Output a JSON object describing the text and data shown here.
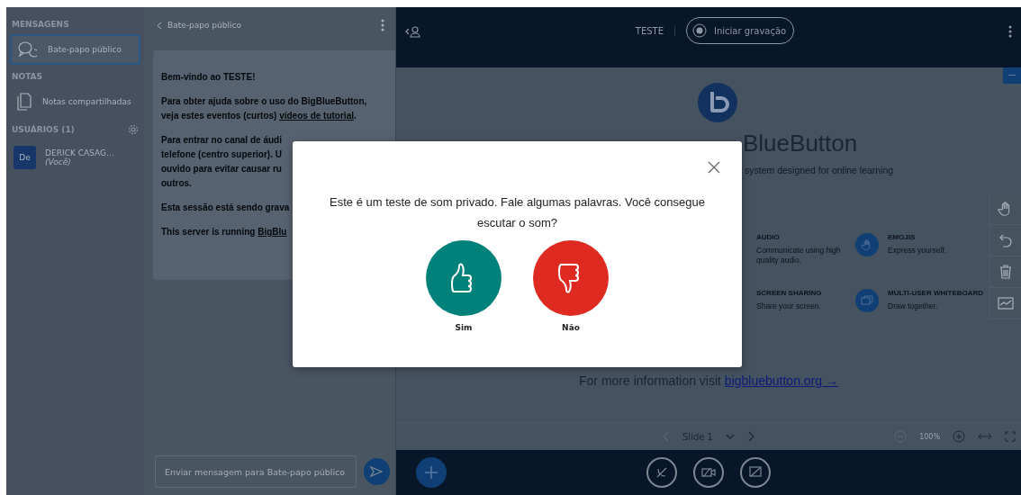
{
  "sidebar": {
    "sections": [
      {
        "title": "MENSAGENS",
        "items": [
          {
            "kind": "chat",
            "label": "Bate-papo público",
            "selected": true
          }
        ]
      },
      {
        "title": "NOTAS",
        "items": [
          {
            "kind": "notes",
            "label": "Notas compartilhadas",
            "selected": false
          }
        ]
      }
    ],
    "users": {
      "title": "USUÁRIOS (1)",
      "list": [
        {
          "avatar": "De",
          "name": "DERICK CASAG…",
          "tag": "(Você)"
        }
      ]
    }
  },
  "chat": {
    "title": "Bate-papo público",
    "messages": [
      {
        "lines": [
          [
            {
              "kind": "text",
              "text": "Bem-vindo ao **TESTE!**"
            }
          ]
        ]
      },
      {
        "lines": [
          [
            {
              "kind": "text",
              "text": "Para obter ajuda sobre o uso do BigBlueButton,"
            }
          ],
          [
            {
              "kind": "text",
              "text": "veja estes eventos (curtos) "
            },
            {
              "kind": "link",
              "text": "vídeos de tutorial"
            },
            {
              "kind": "text",
              "text": "."
            }
          ]
        ]
      },
      {
        "lines": [
          [
            {
              "kind": "text",
              "text": "Para entrar no canal de áudi"
            }
          ],
          [
            {
              "kind": "text",
              "text": "telefone (centro superior). **U**"
            }
          ],
          [
            {
              "kind": "text",
              "text": "**ouvido para evitar causar ru**"
            }
          ],
          [
            {
              "kind": "text",
              "text": "**outros.**"
            }
          ]
        ]
      },
      {
        "lines": [
          [
            {
              "kind": "text",
              "text": "Esta sessão está sendo grava"
            }
          ]
        ]
      },
      {
        "lines": [
          [
            {
              "kind": "text",
              "text": "This server is running "
            },
            {
              "kind": "link",
              "text": "BigBlu"
            }
          ]
        ]
      }
    ],
    "input": {
      "placeholder": "Enviar mensagem para Bate-papo público"
    }
  },
  "topbar": {
    "title": "TESTE",
    "record": {
      "label": "Iniciar gravação",
      "on": false
    }
  },
  "slide": {
    "title": "BlueButton",
    "subtitle": "system designed for online learning",
    "features": [
      {
        "kind": "hidden",
        "title": "AUDIO",
        "text": "Communicate using high quality audio."
      },
      {
        "kind": "hand",
        "title": "EMOJIS",
        "text": "Express yourself."
      },
      {
        "kind": "hidden",
        "title": "SCREEN SHARING",
        "text": "Share your screen."
      },
      {
        "kind": "board",
        "title": "MULTI-USER WHITEBOARD",
        "text": "Draw together."
      }
    ],
    "more": {
      "text": "For more information visit ",
      "link": "bigbluebutton.org →"
    }
  },
  "slide_controls": {
    "slide": "Slide 1",
    "zoom": "100%"
  },
  "modal": {
    "message": "Este é um teste de som privado. Fale algumas palavras. Você consegue escutar o som?",
    "buttons": [
      {
        "kind": "yes",
        "label": "Sim"
      },
      {
        "kind": "no",
        "label": "Não"
      }
    ]
  }
}
